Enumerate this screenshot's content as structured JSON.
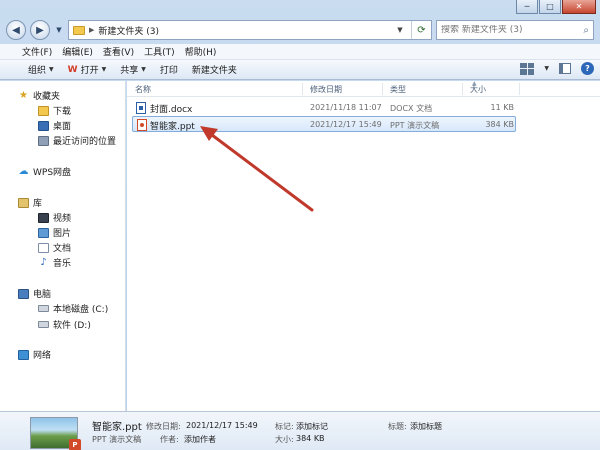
{
  "window": {
    "caption": {
      "minimize": "─",
      "maximize": "□",
      "close": "✕"
    }
  },
  "address": {
    "path": "新建文件夹 (3)",
    "search_placeholder": "搜索 新建文件夹 (3)"
  },
  "menu": [
    "文件(F)",
    "编辑(E)",
    "查看(V)",
    "工具(T)",
    "帮助(H)"
  ],
  "toolbar": {
    "organize": "组织",
    "open": "打开",
    "share": "共享",
    "print": "打印",
    "new_folder": "新建文件夹",
    "wps_mark": "W"
  },
  "navpane": {
    "favorites": "收藏夹",
    "favorites_items": [
      "下载",
      "桌面",
      "最近访问的位置"
    ],
    "wps_cloud": "WPS网盘",
    "libraries": "库",
    "library_items": [
      "视频",
      "图片",
      "文档",
      "音乐"
    ],
    "computer": "电脑",
    "computer_items": [
      "本地磁盘 (C:)",
      "软件 (D:)"
    ],
    "network": "网络"
  },
  "columns": {
    "name": "名称",
    "modified": "修改日期",
    "type": "类型",
    "size": "大小"
  },
  "files": [
    {
      "name": "封面.docx",
      "modified": "2021/11/18 11:07",
      "type": "DOCX 文档",
      "size": "11 KB",
      "icon": "docx-icon"
    },
    {
      "name": "智能家.ppt",
      "modified": "2021/12/17 15:49",
      "type": "PPT 演示文稿",
      "size": "384 KB",
      "icon": "ppt-icon"
    }
  ],
  "details": {
    "name": "智能家.ppt",
    "type": "PPT 演示文稿",
    "modified_label": "修改日期:",
    "modified_value": "2021/12/17 15:49",
    "author_label": "作者:",
    "author_value": "添加作者",
    "tags_label": "标记:",
    "tags_value": "添加标记",
    "size_label": "大小:",
    "size_value": "384 KB",
    "title_label": "标题:",
    "title_value": "添加标题",
    "badge": "P"
  },
  "colors": {
    "annotation_arrow": "#c0392b",
    "selection_border": "#84acdd"
  }
}
